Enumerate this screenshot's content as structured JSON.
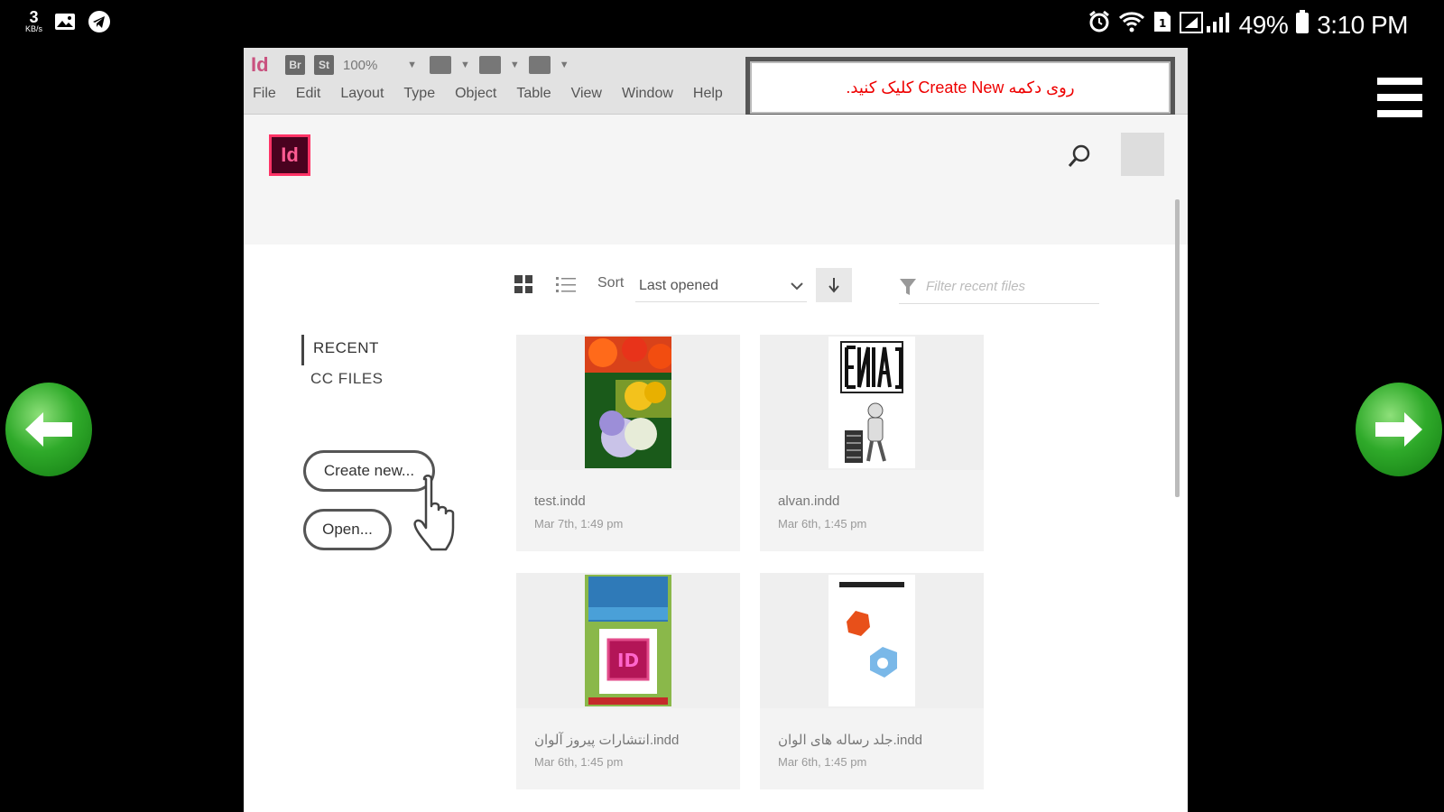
{
  "status_bar": {
    "speed_value": "3",
    "speed_unit": "KB/s",
    "battery": "49%",
    "time": "3:10 PM"
  },
  "window": {
    "app_badge": "Id",
    "toolbar": {
      "br_label": "Br",
      "st_label": "St",
      "zoom": "100%"
    },
    "menu": [
      "File",
      "Edit",
      "Layout",
      "Type",
      "Object",
      "Table",
      "View",
      "Window",
      "Help"
    ]
  },
  "callout": {
    "text": "روی دکمه Create New کلیک کنید."
  },
  "home": {
    "logo": "Id",
    "nav": [
      {
        "label": "RECENT"
      },
      {
        "label": "CC FILES"
      }
    ],
    "create_label": "Create new...",
    "open_label": "Open...",
    "sort_label": "Sort",
    "sort_value": "Last opened",
    "filter_placeholder": "Filter recent files",
    "files": [
      {
        "name": "test.indd",
        "date": "Mar 7th, 1:49 pm",
        "thumb": "flowers"
      },
      {
        "name": "alvan.indd",
        "date": "Mar 6th, 1:45 pm",
        "thumb": "eniac"
      },
      {
        "name": "انتشارات پیروز آلوان.indd",
        "date": "Mar 6th, 1:45 pm",
        "thumb": "indesign-book"
      },
      {
        "name": "جلد رساله های الوان.indd",
        "date": "Mar 6th, 1:45 pm",
        "thumb": "alvan-cover"
      }
    ]
  },
  "colors": {
    "accent_red": "#ee0000",
    "id_brand": "#ff3366",
    "arrow_green": "#2faa2a"
  }
}
